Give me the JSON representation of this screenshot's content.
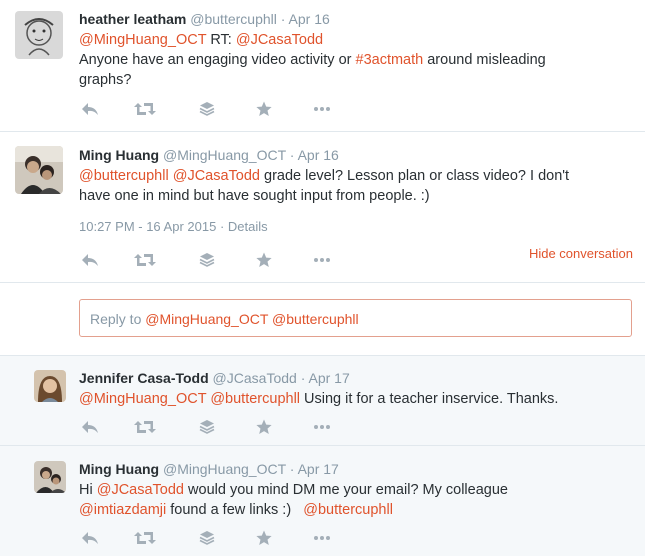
{
  "colors": {
    "accent": "#e0532c",
    "muted": "#8899a6",
    "reply_bg": "#f5f8fa"
  },
  "tweets": [
    {
      "fullname": "heather leatham",
      "screen_name": "@buttercuphll",
      "date": "Apr 16",
      "line1": {
        "m1": "@MingHuang_OCT",
        "t1": " RT: ",
        "m2": "@JCasaTodd"
      },
      "line2": {
        "t1": "Anyone have an engaging video activity or ",
        "h1": "#3actmath",
        "t2": " around misleading"
      },
      "line3": "graphs?",
      "avatar": "sketch-avatar"
    },
    {
      "fullname": "Ming Huang",
      "screen_name": "@MingHuang_OCT",
      "date": "Apr 16",
      "line1": {
        "m1": "@buttercuphll",
        "t1": " ",
        "m2": "@JCasaTodd",
        "t2": " grade level? Lesson plan or class video? I don't"
      },
      "line2": "have one in mind but have sought input from people. :)",
      "timestamp": "10:27 PM - 16 Apr 2015",
      "details": "Details",
      "hide_conversation": "Hide conversation",
      "avatar": "photo-avatar"
    },
    {
      "fullname": "Jennifer Casa-Todd",
      "screen_name": "@JCasaTodd",
      "date": "Apr 17",
      "line1": {
        "m1": "@MingHuang_OCT",
        "t1": " ",
        "m2": "@buttercuphll",
        "t2": " Using it for a teacher inservice. Thanks."
      },
      "avatar": "photo-avatar"
    },
    {
      "fullname": "Ming Huang",
      "screen_name": "@MingHuang_OCT",
      "date": "Apr 17",
      "line1": {
        "t1": "Hi ",
        "m1": "@JCasaTodd",
        "t2": " would you mind DM me your email? My colleague"
      },
      "line2": {
        "m1": "@imtiazdamji",
        "t1": " found a few links :)   ",
        "m2": "@buttercuphll"
      },
      "avatar": "photo-avatar"
    }
  ],
  "reply": {
    "prefix": "Reply to ",
    "m1": "@MingHuang_OCT",
    "space": " ",
    "m2": "@buttercuphll"
  },
  "dot": "·",
  "icons": [
    "reply-icon",
    "retweet-icon",
    "stack-icon",
    "favorite-icon",
    "more-icon"
  ]
}
